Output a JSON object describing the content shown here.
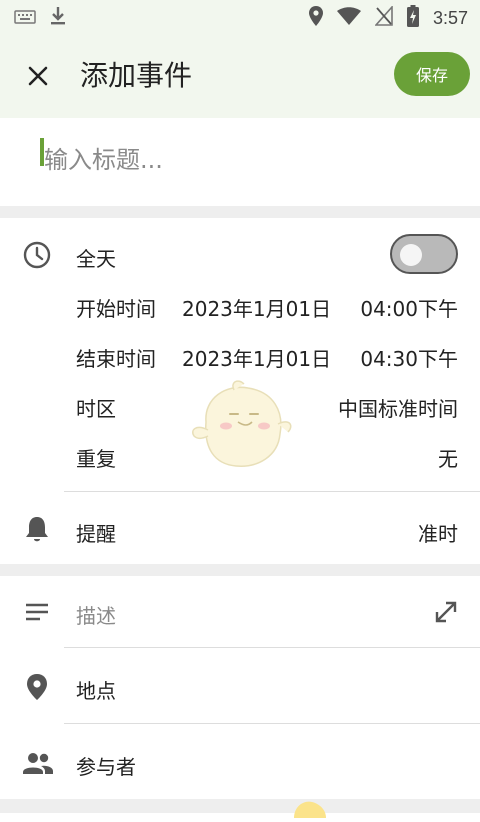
{
  "status_bar": {
    "time": "3:57",
    "icons": [
      "keyboard-icon",
      "download-icon",
      "location-icon",
      "wifi-icon",
      "no-sim-icon",
      "battery-charging-icon"
    ]
  },
  "header": {
    "title": "添加事件",
    "save_label": "保存"
  },
  "event_title": {
    "placeholder": "输入标题..."
  },
  "all_day": {
    "label": "全天",
    "enabled": false
  },
  "start": {
    "label": "开始时间",
    "date": "2023年1月01日",
    "time": "04:00下午"
  },
  "end": {
    "label": "结束时间",
    "date": "2023年1月01日",
    "time": "04:30下午"
  },
  "timezone": {
    "label": "时区",
    "value": "中国标准时间"
  },
  "repeat": {
    "label": "重复",
    "value": "无"
  },
  "reminder": {
    "label": "提醒",
    "value": "准时"
  },
  "description": {
    "placeholder": "描述"
  },
  "location": {
    "label": "地点"
  },
  "attendees": {
    "label": "参与者"
  },
  "colors": {
    "accent": "#6aa138",
    "header_bg": "#f2f7ee",
    "separator": "#eeeeee"
  }
}
